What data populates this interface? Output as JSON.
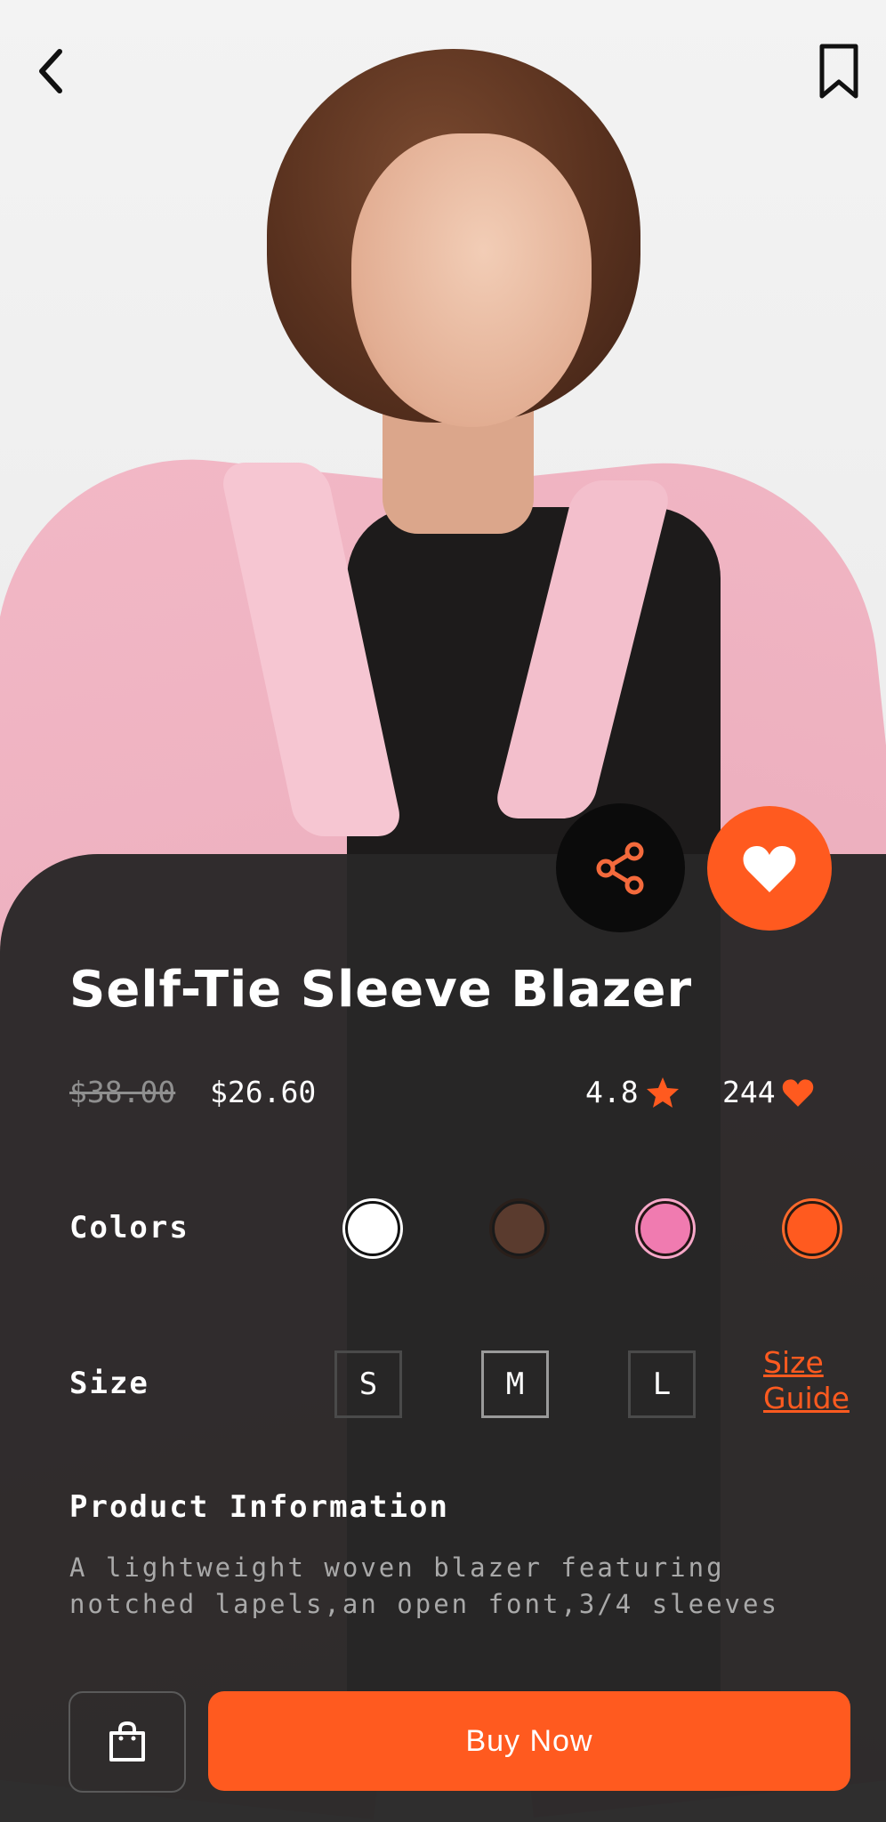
{
  "product": {
    "title": "Self-Tie Sleeve Blazer",
    "old_price": "$38.00",
    "price": "$26.60",
    "rating": "4.8",
    "likes": "244"
  },
  "labels": {
    "colors": "Colors",
    "size": "Size",
    "size_guide": "Size Guide",
    "product_information": "Product Information"
  },
  "product_information_text": "A lightweight woven blazer featuring notched lapels,an open font,3/4 sleeves",
  "colors": [
    "#ffffff",
    "#5a3b2e",
    "#f07bb0",
    "#ff5a1f"
  ],
  "sizes": [
    "S",
    "M",
    "L"
  ],
  "actions": {
    "buy_now": "Buy Now"
  },
  "theme": {
    "accent": "#ff5a1f",
    "panel": "#282626"
  },
  "icons": {
    "back": "chevron-left-icon",
    "bookmark": "bookmark-icon",
    "share": "share-icon",
    "favorite": "heart-icon",
    "rating": "star-icon",
    "likes": "heart-icon",
    "cart": "shopping-bag-icon"
  }
}
